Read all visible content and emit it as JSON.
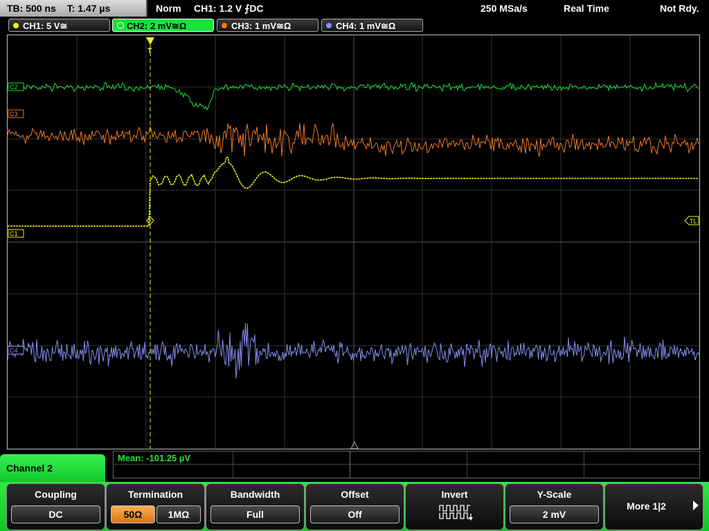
{
  "status_bar": {
    "timebase": "TB: 500 ns",
    "trigger_time": "T: 1.47 µs",
    "trigger_mode": "Norm",
    "trigger_info": "CH1: 1.2 V ⨍DC",
    "sample_rate": "250 MSa/s",
    "acq_mode": "Real Time",
    "state": "Not Rdy."
  },
  "channels": [
    {
      "label": "CH1: 5 V≅",
      "color": "#f2f21a"
    },
    {
      "label": "CH2: 2 mV≅Ω",
      "color": "#17e33b"
    },
    {
      "label": "CH3: 1 mV≅Ω",
      "color": "#f07a22"
    },
    {
      "label": "CH4: 1 mV≅Ω",
      "color": "#8c8cf0"
    }
  ],
  "markers": {
    "c2": "C2",
    "c3": "C3",
    "c1": "C1",
    "c4": "C4",
    "trigger_level": "TL",
    "trigger_pos": "T"
  },
  "measurement": {
    "text": "Mean: -101.25 µV"
  },
  "menu": {
    "title": "Channel 2",
    "coupling": {
      "title": "Coupling",
      "value": "DC"
    },
    "termination": {
      "title": "Termination",
      "opt_a": "50Ω",
      "opt_b": "1MΩ",
      "selected": "50Ω"
    },
    "bandwidth": {
      "title": "Bandwidth",
      "value": "Full"
    },
    "offset": {
      "title": "Offset",
      "value": "Off"
    },
    "invert": {
      "title": "Invert",
      "icon": "invert-waveform-icon"
    },
    "yscale": {
      "title": "Y-Scale",
      "value": "2 mV"
    },
    "more": {
      "label": "More 1|2"
    }
  }
}
